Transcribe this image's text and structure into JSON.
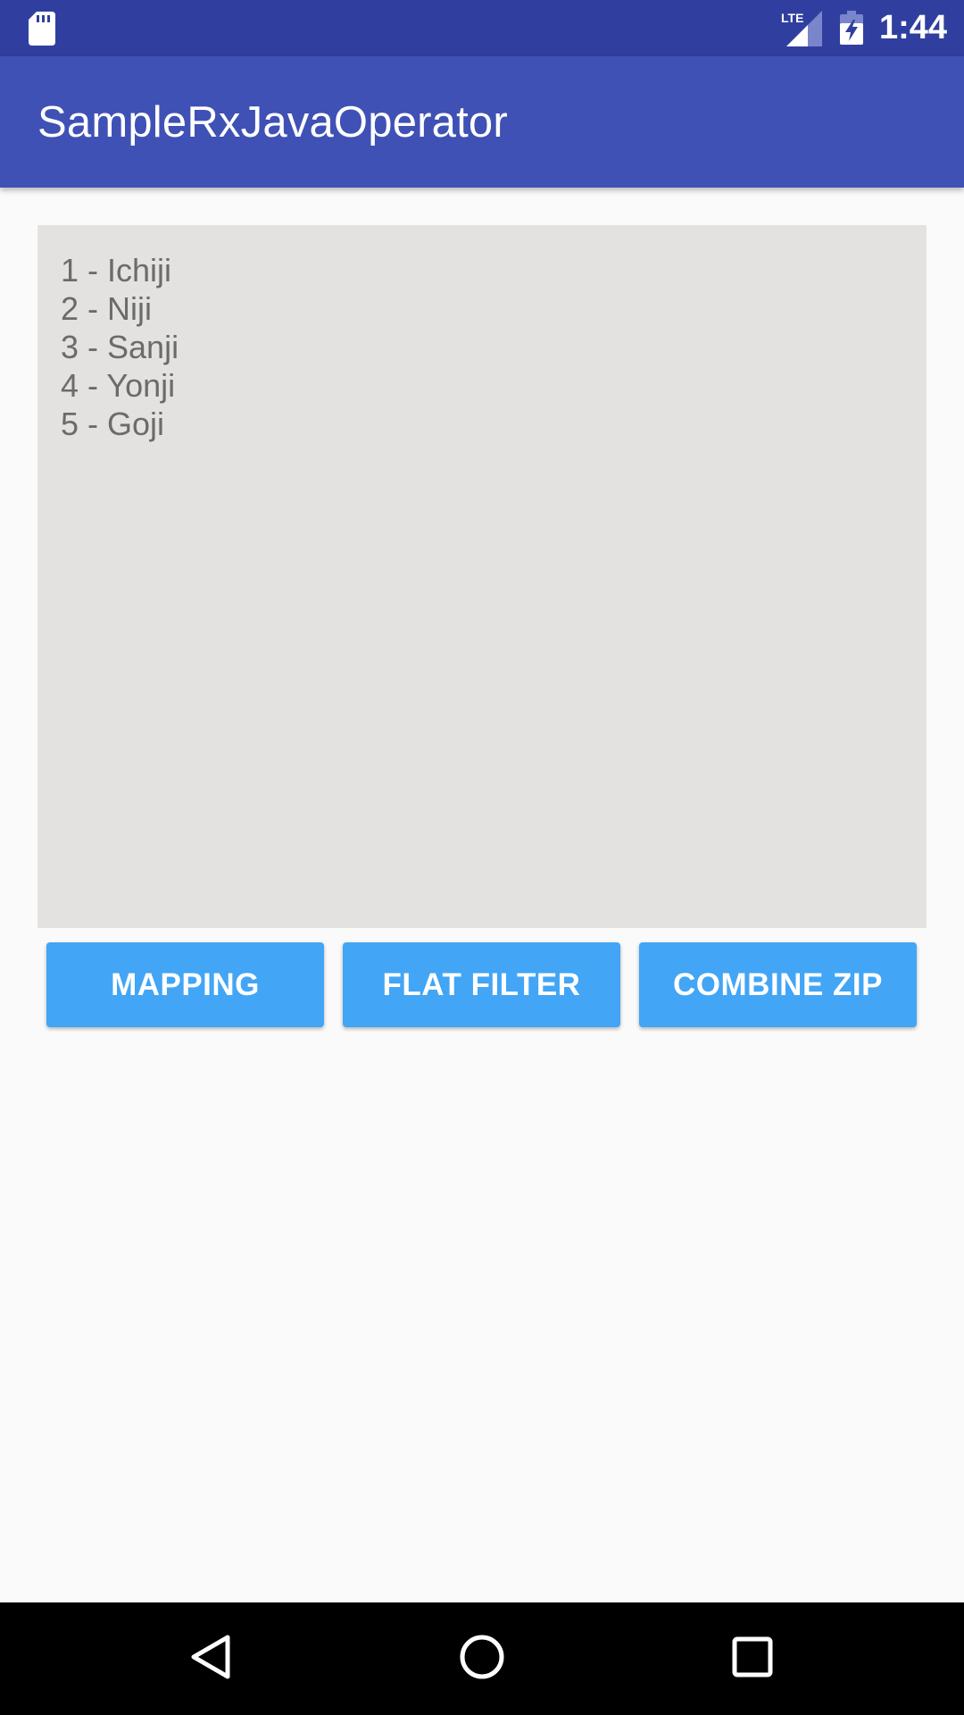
{
  "status_bar": {
    "time": "1:44",
    "network_label": "LTE",
    "icons": [
      "sd-card-icon",
      "lte-signal-icon",
      "battery-charging-icon"
    ]
  },
  "app_bar": {
    "title": "SampleRxJavaOperator"
  },
  "output": {
    "lines": [
      "1 - Ichiji",
      "2 - Niji",
      "3 - Sanji",
      "4 - Yonji",
      "5 - Goji"
    ]
  },
  "buttons": {
    "mapping": "MAPPING",
    "flat_filter": "FLAT FILTER",
    "combine_zip": "COMBINE ZIP"
  },
  "nav_bar": {
    "icons": [
      "back-icon",
      "home-icon",
      "recents-icon"
    ]
  },
  "colors": {
    "status_bar": "#303f9f",
    "app_bar": "#3f51b5",
    "button": "#42a5f5",
    "panel": "#e3e2e0",
    "background": "#fafafa"
  }
}
